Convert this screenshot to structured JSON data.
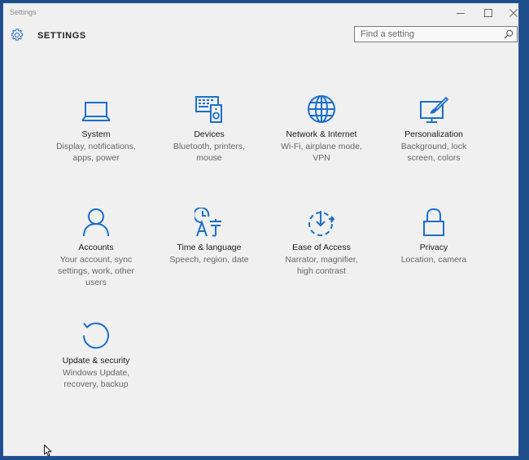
{
  "window": {
    "app_title": "Settings"
  },
  "header": {
    "title": "SETTINGS",
    "search_placeholder": "Find a setting"
  },
  "icons": {
    "accent": "#1c6fc9",
    "names": [
      "laptop-icon",
      "keyboard-speaker-icon",
      "globe-icon",
      "paint-brush-icon",
      "person-icon",
      "clock-language-icon",
      "ease-of-access-icon",
      "lock-icon",
      "refresh-icon"
    ]
  },
  "tiles": [
    {
      "name": "System",
      "desc": [
        "Display, notifications,",
        "apps, power"
      ]
    },
    {
      "name": "Devices",
      "desc": [
        "Bluetooth, printers,",
        "mouse"
      ]
    },
    {
      "name": "Network & Internet",
      "desc": [
        "Wi-Fi, airplane mode,",
        "VPN"
      ]
    },
    {
      "name": "Personalization",
      "desc": [
        "Background, lock",
        "screen, colors"
      ]
    },
    {
      "name": "Accounts",
      "desc": [
        "Your account, sync",
        "settings, work, other",
        "users"
      ]
    },
    {
      "name": "Time & language",
      "desc": [
        "Speech, region, date"
      ]
    },
    {
      "name": "Ease of Access",
      "desc": [
        "Narrator, magnifier,",
        "high contrast"
      ]
    },
    {
      "name": "Privacy",
      "desc": [
        "Location, camera"
      ]
    },
    {
      "name": "Update & security",
      "desc": [
        "Windows Update,",
        "recovery, backup"
      ]
    }
  ]
}
